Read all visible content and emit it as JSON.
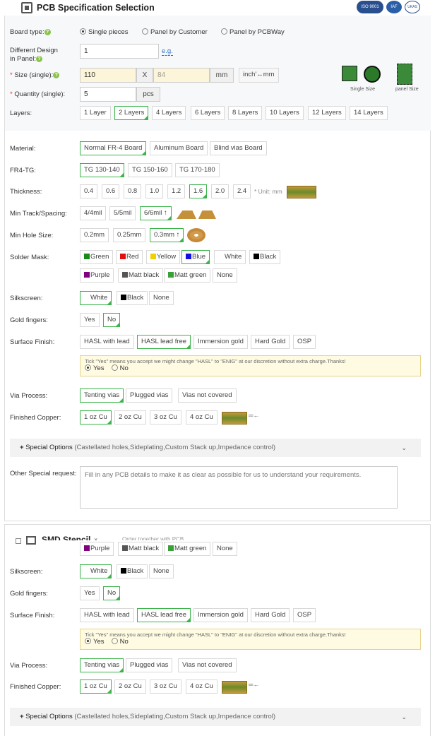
{
  "header": {
    "title": "PCB Specification Selection",
    "certs": [
      "ISO 9001",
      "IAF",
      "UKAS"
    ]
  },
  "board_type": {
    "label": "Board type:",
    "options": [
      "Single pieces",
      "Panel by Customer",
      "Panel by PCBWay"
    ],
    "selected": 0
  },
  "different_design": {
    "label1": "Different Design",
    "label2": "in Panel:",
    "value": "1",
    "eg": "e.g."
  },
  "size": {
    "label": "Size (single):",
    "req": "*",
    "w": "110",
    "x": "X",
    "h": "84",
    "unit": "mm",
    "toggle": "inch'↔mm"
  },
  "quantity": {
    "label": "Quantity (single):",
    "req": "*",
    "value": "5",
    "unit": "pcs"
  },
  "preview": {
    "single": "Single Size",
    "panel": "panel Size"
  },
  "layers": {
    "label": "Layers:",
    "options": [
      "1 Layer",
      "2 Layers",
      "4 Layers",
      "6 Layers",
      "8 Layers",
      "10 Layers",
      "12 Layers",
      "14 Layers"
    ],
    "selected": 1
  },
  "material": {
    "label": "Material:",
    "options": [
      "Normal FR-4 Board",
      "Aluminum Board",
      "Blind vias Board"
    ],
    "selected": 0
  },
  "fr4tg": {
    "label": "FR4-TG:",
    "options": [
      "TG 130-140",
      "TG 150-160",
      "TG 170-180"
    ],
    "selected": 0
  },
  "thickness": {
    "label": "Thickness:",
    "options": [
      "0.4",
      "0.6",
      "0.8",
      "1.0",
      "1.2",
      "1.6",
      "2.0",
      "2.4"
    ],
    "selected": 5,
    "unit": "* Unit: mm"
  },
  "track": {
    "label": "Min Track/Spacing:",
    "options": [
      "4/4mil",
      "5/5mil",
      "6/6mil ↑"
    ],
    "selected": 2
  },
  "hole": {
    "label": "Min Hole Size:",
    "options": [
      "0.2mm",
      "0.25mm",
      "0.3mm ↑"
    ],
    "selected": 2
  },
  "solder": {
    "label": "Solder Mask:",
    "row1": [
      {
        "t": "Green",
        "c": "#1a8a1a"
      },
      {
        "t": "Red",
        "c": "#e01010"
      },
      {
        "t": "Yellow",
        "c": "#f0d000"
      },
      {
        "t": "Blue",
        "c": "#1010e0"
      },
      {
        "t": "White",
        "c": "#ffffff"
      },
      {
        "t": "Black",
        "c": "#000000"
      }
    ],
    "row2": [
      {
        "t": "Purple",
        "c": "#800080"
      },
      {
        "t": "Matt black",
        "c": "#555555"
      },
      {
        "t": "Matt green",
        "c": "#3aa03a"
      },
      {
        "t": "None",
        "c": ""
      }
    ],
    "selected": "Blue"
  },
  "silk": {
    "label": "Silkscreen:",
    "options": [
      "White",
      "Black",
      "None"
    ],
    "selected": 0,
    "swatch_white": "#ffffff",
    "swatch_black": "#000000"
  },
  "gold": {
    "label": "Gold fingers:",
    "options": [
      "Yes",
      "No"
    ],
    "selected": 1
  },
  "finish": {
    "label": "Surface Finish:",
    "options": [
      "HASL with lead",
      "HASL lead free",
      "Immersion gold",
      "Hard Gold",
      "OSP"
    ],
    "selected": 1,
    "note": "Tick \"Yes\" means you accept we might change \"HASL\" to \"ENIG\" at our discretion without extra charge.Thanks!",
    "yes": "Yes",
    "no": "No"
  },
  "via": {
    "label": "Via Process:",
    "options": [
      "Tenting vias",
      "Plugged vias",
      "Vias not covered"
    ],
    "selected": 0
  },
  "copper": {
    "label": "Finished Copper:",
    "options": [
      "1 oz Cu",
      "2 oz Cu",
      "3 oz Cu",
      "4 oz Cu"
    ],
    "selected": 0
  },
  "special": {
    "title": "Special Options",
    "sub": "(Castellated holes,Sideplating,Custom Stack up,Impedance control)"
  },
  "other": {
    "label": "Other Special request:",
    "placeholder": "Fill in any PCB details to make it as clear as possible for us to understand your requirements."
  },
  "stencil": {
    "title": "SMD Stencil",
    "x": "×",
    "order": "Order together with PCB"
  }
}
